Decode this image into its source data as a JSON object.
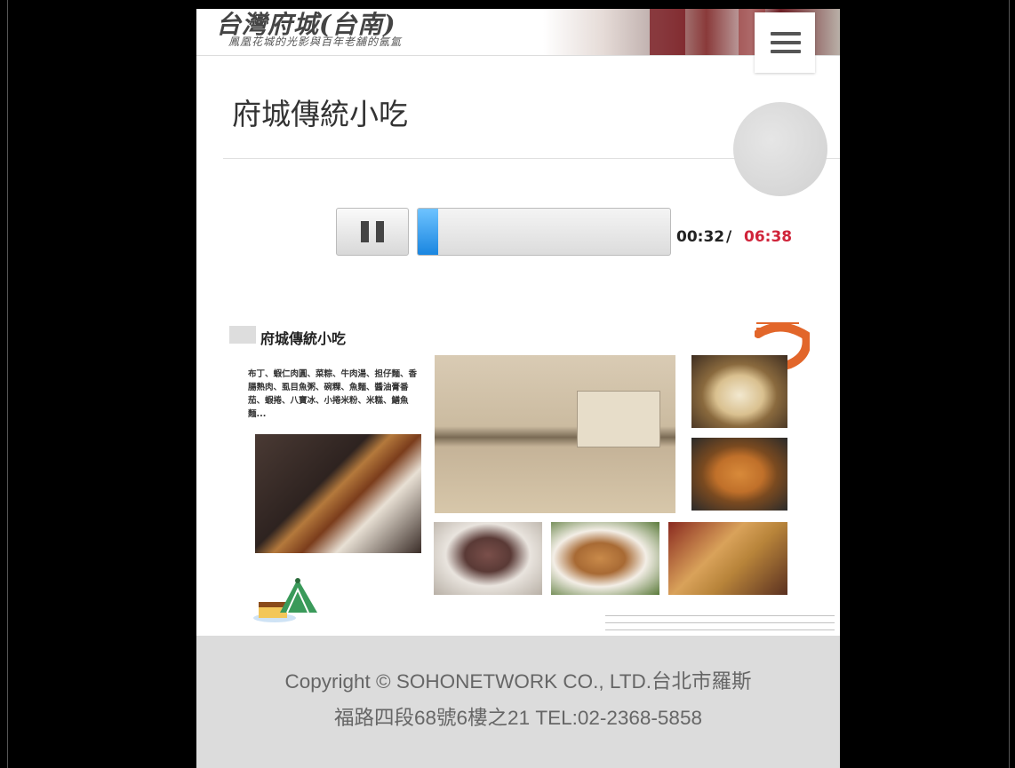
{
  "header": {
    "title": "台灣府城(台南)",
    "subtitle": "鳳凰花城的光影與百年老舖的氤氳"
  },
  "page": {
    "title": "府城傳統小吃"
  },
  "player": {
    "current_time": "00:32",
    "separator": "/",
    "total_time": "06:38",
    "progress_fraction": 0.08
  },
  "slide": {
    "heading": "府城傳統小吃",
    "description": "布丁、蝦仁肉圓、菜粽、牛肉湯、担仔麵、香腸熟肉、虱目魚粥、碗粿、魚麵、醬油膏番茄、蝦捲、八寶冰、小捲米粉、米糕、鱔魚麵..."
  },
  "footer": {
    "line1": "Copyright © SOHONETWORK CO., LTD.台北市羅斯",
    "line2": "福路四段68號6樓之21 TEL:02-2368-5858"
  },
  "colors": {
    "total_time": "#d0243a",
    "progress_fill": "#1a86e0"
  }
}
